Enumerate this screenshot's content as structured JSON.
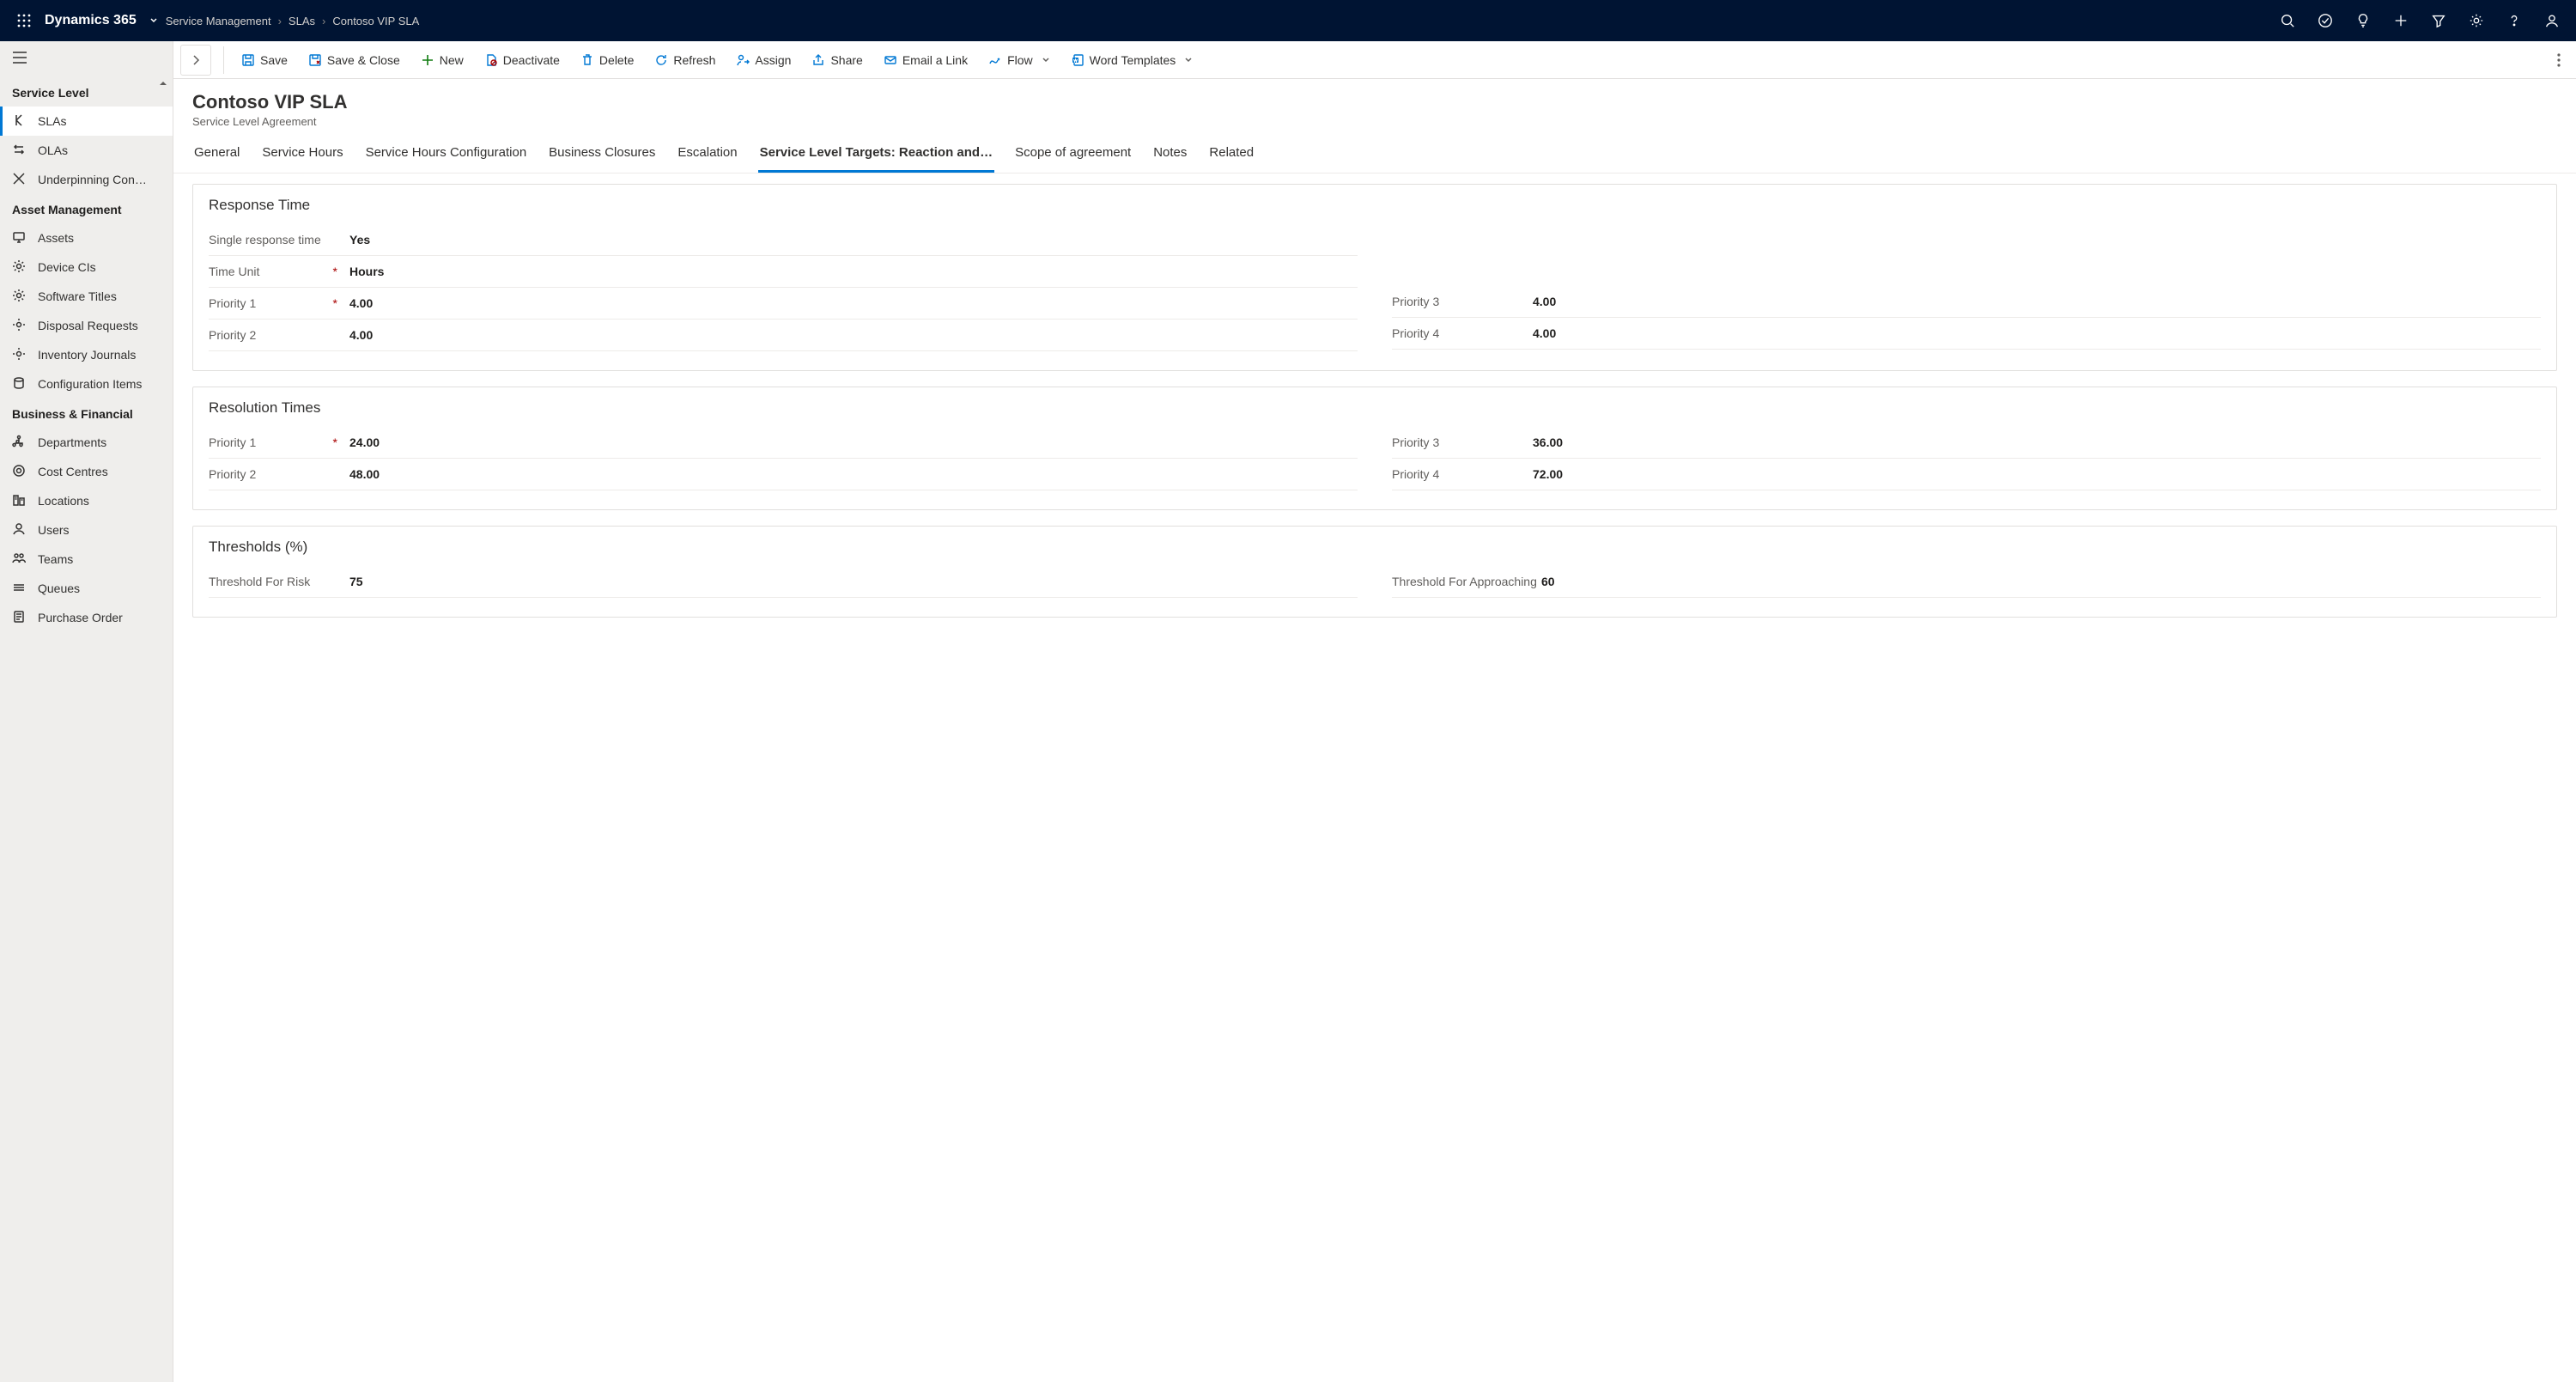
{
  "brand": "Dynamics 365",
  "breadcrumbs": [
    "Service Management",
    "SLAs",
    "Contoso VIP SLA"
  ],
  "topIcons": [
    "search",
    "task",
    "lightbulb",
    "add",
    "filter",
    "settings",
    "help",
    "persona"
  ],
  "sidebar": {
    "sections": [
      {
        "title": "Service Level",
        "items": [
          {
            "icon": "slas",
            "label": "SLAs",
            "active": true
          },
          {
            "icon": "olas",
            "label": "OLAs"
          },
          {
            "icon": "under",
            "label": "Underpinning Con…"
          }
        ]
      },
      {
        "title": "Asset Management",
        "items": [
          {
            "icon": "assets",
            "label": "Assets"
          },
          {
            "icon": "device",
            "label": "Device CIs"
          },
          {
            "icon": "software",
            "label": "Software Titles"
          },
          {
            "icon": "disposal",
            "label": "Disposal Requests"
          },
          {
            "icon": "inventory",
            "label": "Inventory Journals"
          },
          {
            "icon": "config",
            "label": "Configuration Items"
          }
        ]
      },
      {
        "title": "Business & Financial",
        "items": [
          {
            "icon": "dept",
            "label": "Departments"
          },
          {
            "icon": "cost",
            "label": "Cost Centres"
          },
          {
            "icon": "loc",
            "label": "Locations"
          },
          {
            "icon": "users",
            "label": "Users"
          },
          {
            "icon": "teams",
            "label": "Teams"
          },
          {
            "icon": "queues",
            "label": "Queues"
          },
          {
            "icon": "po",
            "label": "Purchase Order"
          }
        ]
      }
    ]
  },
  "commandBar": [
    {
      "icon": "save",
      "label": "Save"
    },
    {
      "icon": "saveclose",
      "label": "Save & Close"
    },
    {
      "icon": "new",
      "label": "New",
      "cls": "new"
    },
    {
      "icon": "deactivate",
      "label": "Deactivate"
    },
    {
      "icon": "delete",
      "label": "Delete"
    },
    {
      "icon": "refresh",
      "label": "Refresh"
    },
    {
      "icon": "assign",
      "label": "Assign"
    },
    {
      "icon": "share",
      "label": "Share"
    },
    {
      "icon": "email",
      "label": "Email a Link"
    },
    {
      "icon": "flow",
      "label": "Flow",
      "caret": true
    },
    {
      "icon": "word",
      "label": "Word Templates",
      "caret": true
    }
  ],
  "record": {
    "title": "Contoso VIP SLA",
    "subtitle": "Service Level Agreement"
  },
  "tabs": [
    {
      "label": "General"
    },
    {
      "label": "Service Hours"
    },
    {
      "label": "Service Hours Configuration"
    },
    {
      "label": "Business Closures"
    },
    {
      "label": "Escalation"
    },
    {
      "label": "Service Level Targets: Reaction and…",
      "active": true
    },
    {
      "label": "Scope of agreement"
    },
    {
      "label": "Notes"
    },
    {
      "label": "Related"
    }
  ],
  "sections": {
    "response": {
      "title": "Response Time",
      "single": {
        "label": "Single response time",
        "value": "Yes"
      },
      "unit": {
        "label": "Time Unit",
        "value": "Hours",
        "req": true
      },
      "left": [
        {
          "label": "Priority 1",
          "value": "4.00",
          "req": true
        },
        {
          "label": "Priority 2",
          "value": "4.00"
        }
      ],
      "right": [
        {
          "label": "Priority 3",
          "value": "4.00"
        },
        {
          "label": "Priority 4",
          "value": "4.00"
        }
      ]
    },
    "resolution": {
      "title": "Resolution Times",
      "left": [
        {
          "label": "Priority 1",
          "value": "24.00",
          "req": true
        },
        {
          "label": "Priority 2",
          "value": "48.00"
        }
      ],
      "right": [
        {
          "label": "Priority 3",
          "value": "36.00"
        },
        {
          "label": "Priority 4",
          "value": "72.00"
        }
      ]
    },
    "thresholds": {
      "title": "Thresholds (%)",
      "left": [
        {
          "label": "Threshold For Risk",
          "value": "75"
        }
      ],
      "right": [
        {
          "label": "Threshold For Approaching",
          "value": "60"
        }
      ]
    }
  }
}
